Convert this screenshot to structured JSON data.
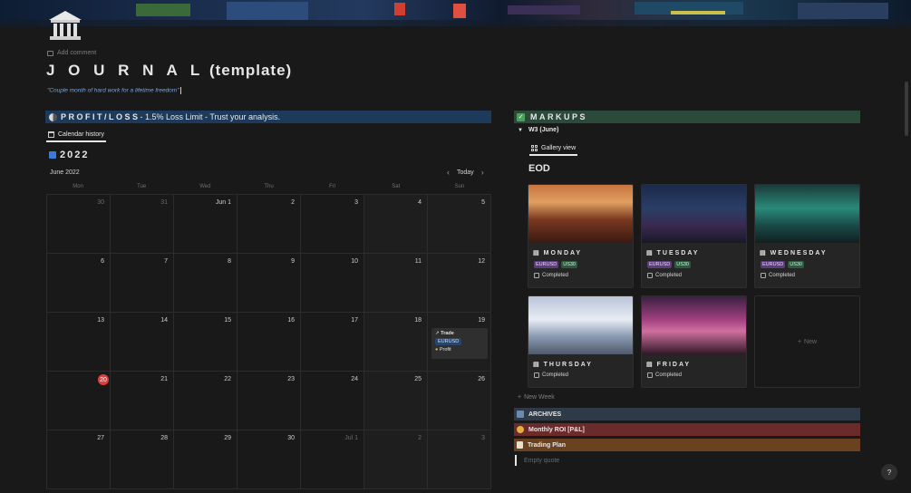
{
  "page": {
    "add_comment": "Add comment",
    "title_spaced": "J O U R N A L",
    "title_rest": " (template)",
    "quote": "\"Couple month of hard work for a lifetime freedom\""
  },
  "profit_loss": {
    "label_spaced": "PROFIT/LOSS",
    "label_rest": " - 1.5% Loss Limit - Trust your analysis.",
    "tab": "Calendar history",
    "year": "2022",
    "month": "June 2022",
    "today_label": "Today",
    "weekdays": [
      "Mon",
      "Tue",
      "Wed",
      "Thu",
      "Fri",
      "Sat",
      "Sun"
    ],
    "days": [
      [
        "30",
        "31",
        "Jun 1",
        "2",
        "3",
        "4",
        "5"
      ],
      [
        "6",
        "7",
        "8",
        "9",
        "10",
        "11",
        "12"
      ],
      [
        "13",
        "14",
        "15",
        "16",
        "17",
        "18",
        "19"
      ],
      [
        "20",
        "21",
        "22",
        "23",
        "24",
        "25",
        "26"
      ],
      [
        "27",
        "28",
        "29",
        "30",
        "Jul 1",
        "2",
        "3"
      ]
    ],
    "event": {
      "title": "Trade",
      "tag": "EURUSD",
      "result": "Profit"
    }
  },
  "markups": {
    "label": "MARKUPS",
    "toggle": "W3 (June)",
    "tab": "Gallery view",
    "heading": "EOD",
    "cards": [
      {
        "name": "MONDAY",
        "tags": [
          "EURUSD",
          "US30"
        ],
        "status": "Completed"
      },
      {
        "name": "TUESDAY",
        "tags": [
          "EURUSD",
          "US30"
        ],
        "status": "Completed"
      },
      {
        "name": "WEDNESDAY",
        "tags": [
          "EURUSD",
          "US30"
        ],
        "status": "Completed"
      },
      {
        "name": "THURSDAY",
        "tags": [],
        "status": "Completed"
      },
      {
        "name": "FRIDAY",
        "tags": [],
        "status": "Completed"
      }
    ],
    "new_card": "New",
    "new_week": "New Week",
    "links": [
      {
        "label": "ARCHIVES",
        "color": "#2f3a48"
      },
      {
        "label": "Monthly ROI [P&L]",
        "color": "#6b2b2b"
      },
      {
        "label": "Trading Plan",
        "color": "#6b4220"
      }
    ],
    "empty_quote": "Empty quote"
  },
  "help": "?"
}
